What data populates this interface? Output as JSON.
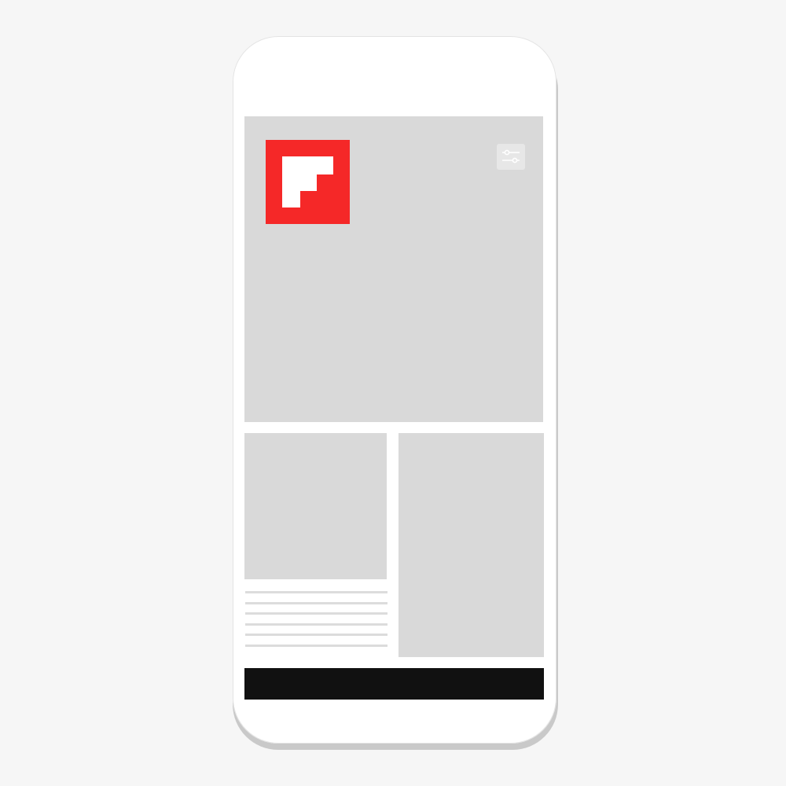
{
  "app": {
    "brand": "Flipboard",
    "brand_color": "#f52828",
    "placeholder_color": "#d9d9d9",
    "bar_color": "#111111"
  },
  "header": {
    "logo_icon": "flipboard-logo-icon",
    "settings_icon": "sliders-icon"
  },
  "feed": {
    "text_line_count": 6
  }
}
